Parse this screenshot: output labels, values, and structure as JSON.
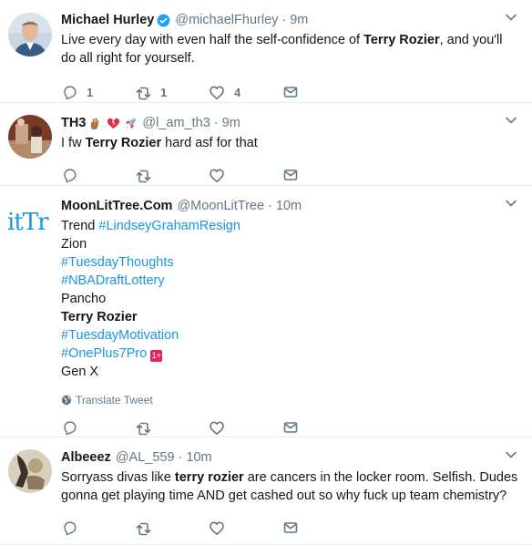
{
  "tweets": [
    {
      "name": "Michael Hurley",
      "handle": "@michaelFhurley",
      "dot": "·",
      "time": "9m",
      "text_before": "Live every day with even half the self-confidence of ",
      "text_bold": "Terry Rozier",
      "text_after": ", and you'll do all right for yourself.",
      "replies": "1",
      "retweets": "1",
      "likes": "4"
    },
    {
      "name": "TH3",
      "handle": "@l_am_th3",
      "dot": "·",
      "time": "9m",
      "text_before": "I fw ",
      "text_bold": "Terry Rozier",
      "text_after": " hard asf for that"
    },
    {
      "name": "MoonLitTree.Com",
      "handle": "@MoonLitTree",
      "dot": "·",
      "time": "10m",
      "avatar_text": "itTr",
      "lines": {
        "trend_label": "Trend ",
        "trend_hashtag": "#LindseyGrahamResign",
        "zion": "Zion",
        "h1": "#TuesdayThoughts",
        "h2": "#NBADraftLottery",
        "pancho": "Pancho",
        "terry": "Terry Rozier",
        "h3": "#TuesdayMotivation",
        "h4": "#OnePlus7Pro",
        "genx": "Gen X"
      },
      "translate": "Translate Tweet"
    },
    {
      "name": "Albeeez",
      "handle": "@AL_559",
      "dot": "·",
      "time": "10m",
      "text_before": "Sorryass divas like ",
      "text_bold": "terry rozier",
      "text_after": " are cancers in the locker room. Selfish. Dudes gonna get playing time AND get cashed out so why fuck up team chemistry?"
    }
  ],
  "colors": {
    "link": "#1b95e0",
    "muted": "#657786",
    "verified": "#1da1f2",
    "divider": "#e6ecf0"
  },
  "icons": [
    "verified-icon",
    "caret-down-icon",
    "reply-icon",
    "retweet-icon",
    "like-icon",
    "dm-icon",
    "globe-icon"
  ]
}
